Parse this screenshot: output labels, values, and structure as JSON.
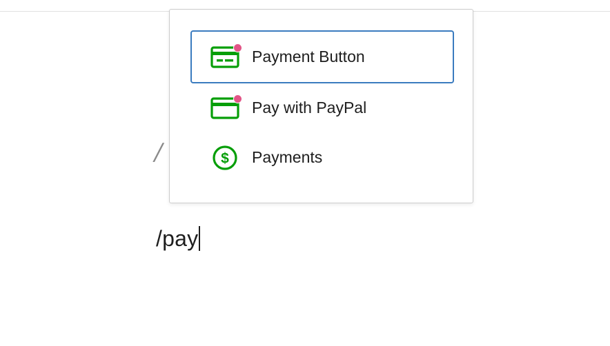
{
  "editor": {
    "typed_text": "/pay"
  },
  "inserter": {
    "options": [
      {
        "label": "Payment Button",
        "icon": "payment-button-card-icon",
        "has_new_badge": true,
        "selected": true
      },
      {
        "label": "Pay with PayPal",
        "icon": "paypal-card-icon",
        "has_new_badge": true,
        "selected": false
      },
      {
        "label": "Payments",
        "icon": "dollar-circle-icon",
        "has_new_badge": false,
        "selected": false
      }
    ]
  },
  "colors": {
    "icon_green": "#069e08",
    "new_badge": "#e25587",
    "selected_outline": "#3a7bbf"
  }
}
